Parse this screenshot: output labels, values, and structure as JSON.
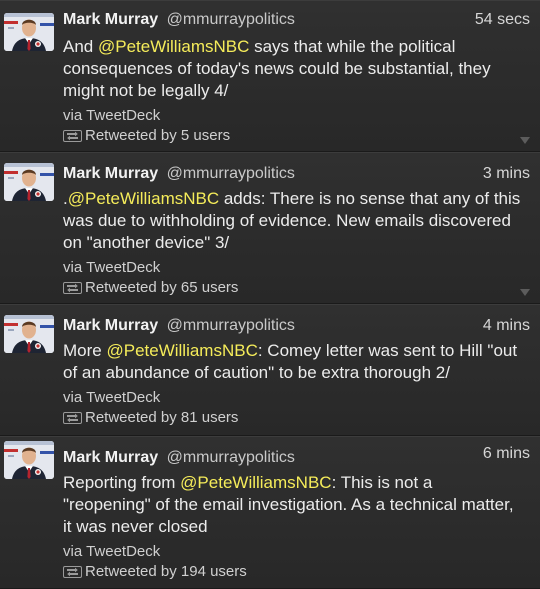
{
  "tweets": [
    {
      "name": "Mark Murray",
      "handle": "@mmurraypolitics",
      "time": "54 secs",
      "text_pre": "And ",
      "mention": "@PeteWilliamsNBC",
      "text_post": " says that while the political consequences of today's news could be substantial, they might not be legally 4/",
      "via": "via TweetDeck",
      "retweeted": "Retweeted by 5 users"
    },
    {
      "name": "Mark Murray",
      "handle": "@mmurraypolitics",
      "time": "3 mins",
      "text_pre": ".",
      "mention": "@PeteWilliamsNBC",
      "text_post": " adds: There is no sense that any of this was due to withholding of evidence. New emails discovered on \"another device\" 3/",
      "via": "via TweetDeck",
      "retweeted": "Retweeted by 65 users"
    },
    {
      "name": "Mark Murray",
      "handle": "@mmurraypolitics",
      "time": "4 mins",
      "text_pre": "More ",
      "mention": "@PeteWilliamsNBC",
      "text_post": ": Comey letter was sent to Hill \"out of an abundance of caution\" to be extra thorough 2/",
      "via": "via TweetDeck",
      "retweeted": "Retweeted by 81 users"
    },
    {
      "name": "Mark Murray",
      "handle": "@mmurraypolitics",
      "time": "6 mins",
      "text_pre": "Reporting from ",
      "mention": "@PeteWilliamsNBC",
      "text_post": ": This is not a \"reopening\" of the email investigation. As a technical matter, it was never closed",
      "via": "via TweetDeck",
      "retweeted": "Retweeted by 194 users"
    }
  ],
  "colors": {
    "background": "#2b2b2b",
    "mention": "#f5ec5a",
    "text": "#ececec"
  },
  "icons": {
    "avatar": "profile-photo",
    "retweet": "retweet-icon",
    "expand": "chevron-down-icon"
  }
}
